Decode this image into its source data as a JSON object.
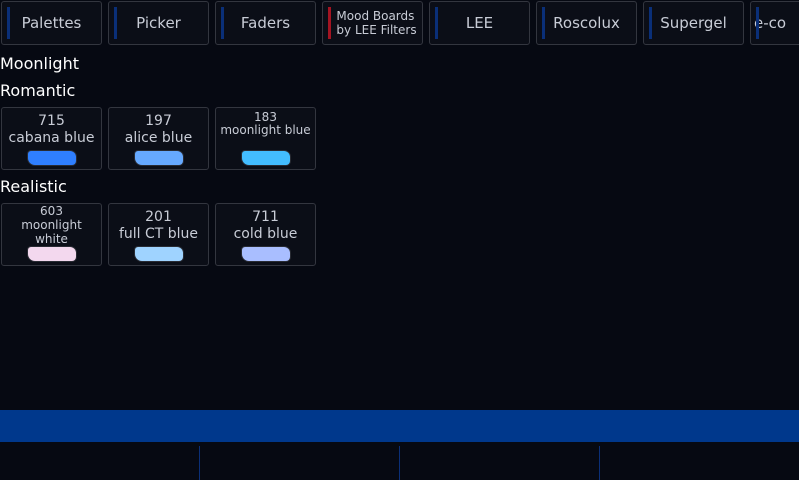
{
  "tabs": [
    {
      "label": "Palettes",
      "active": false
    },
    {
      "label": "Picker",
      "active": false
    },
    {
      "label": "Faders",
      "active": false
    },
    {
      "label": "Mood Boards\nby LEE Filters",
      "active": true
    },
    {
      "label": "LEE",
      "active": false
    },
    {
      "label": "Roscolux",
      "active": false
    },
    {
      "label": "Supergel",
      "active": false
    },
    {
      "label": "e-co",
      "active": false
    }
  ],
  "board": {
    "title": "Moonlight"
  },
  "sections": [
    {
      "title": "Romantic",
      "swatches": [
        {
          "number": "715",
          "name": "cabana blue",
          "color": "#2f7fff"
        },
        {
          "number": "197",
          "name": "alice blue",
          "color": "#66a9ff"
        },
        {
          "number": "183",
          "name": "moonlight blue",
          "color": "#43bdff"
        }
      ]
    },
    {
      "title": "Realistic",
      "swatches": [
        {
          "number": "603",
          "name": "moonlight\nwhite",
          "color": "#f3d8ee"
        },
        {
          "number": "201",
          "name": "full CT blue",
          "color": "#9fd3ff"
        },
        {
          "number": "711",
          "name": "cold blue",
          "color": "#a9beff"
        }
      ]
    }
  ],
  "colors": {
    "accent_active": "#a31422",
    "accent_inactive": "#0a2f78",
    "status_bar": "#00388c",
    "background": "#060912"
  }
}
